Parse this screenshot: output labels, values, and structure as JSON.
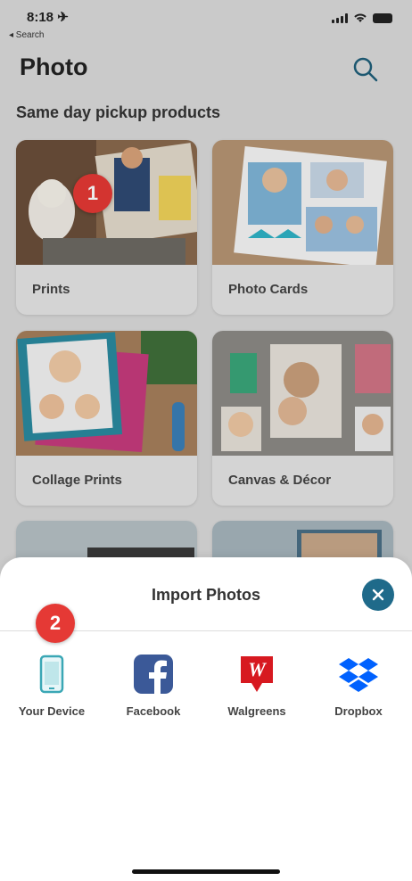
{
  "status_bar": {
    "time": "8:18 ✈",
    "back_label": "◂ Search"
  },
  "header": {
    "title": "Photo"
  },
  "section": {
    "title": "Same day pickup products"
  },
  "products": [
    {
      "label": "Prints"
    },
    {
      "label": "Photo Cards"
    },
    {
      "label": "Collage Prints"
    },
    {
      "label": "Canvas & Décor"
    }
  ],
  "badges": {
    "step1": "1",
    "step2": "2"
  },
  "import_sheet": {
    "title": "Import Photos",
    "sources": [
      {
        "label": "Your Device",
        "icon": "phone-icon"
      },
      {
        "label": "Facebook",
        "icon": "facebook-icon"
      },
      {
        "label": "Walgreens",
        "icon": "walgreens-icon"
      },
      {
        "label": "Dropbox",
        "icon": "dropbox-icon"
      }
    ]
  },
  "colors": {
    "accent": "#1f6a8a",
    "badge": "#e53935",
    "facebook": "#3b5998",
    "walgreens": "#d71920",
    "dropbox": "#0061fe",
    "device": "#3aa7b5"
  }
}
